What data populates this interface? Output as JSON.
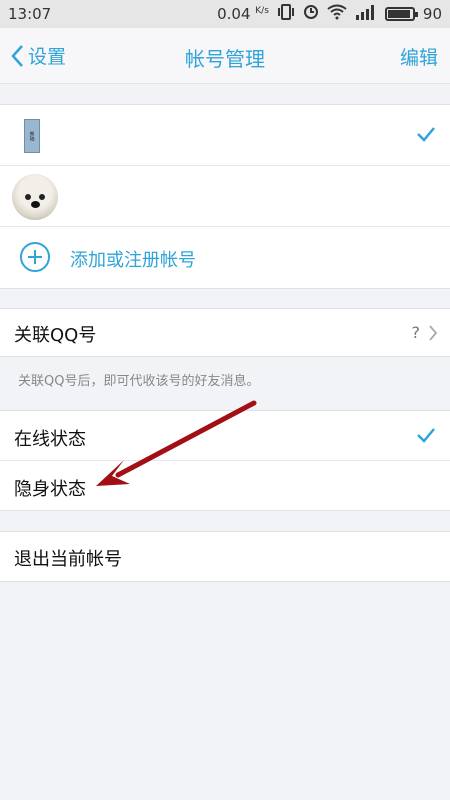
{
  "statusbar": {
    "time": "13:07",
    "speed_value": "0.04",
    "speed_unit": "K/s",
    "battery": "90",
    "icons": [
      "vibrate-icon",
      "alarm-icon",
      "wifi-icon",
      "signal-icon",
      "battery-icon"
    ]
  },
  "navbar": {
    "back_label": "设置",
    "title": "帐号管理",
    "edit_label": "编辑"
  },
  "accounts": {
    "items": [
      {
        "selected": true
      },
      {
        "selected": false
      }
    ],
    "add_label": "添加或注册帐号"
  },
  "link_qq": {
    "label": "关联QQ号",
    "value": "?",
    "hint": "关联QQ号后，即可代收该号的好友消息。"
  },
  "status": {
    "online_label": "在线状态",
    "online_selected": true,
    "invisible_label": "隐身状态",
    "invisible_selected": false
  },
  "logout": {
    "label": "退出当前帐号"
  },
  "colors": {
    "accent": "#2fa4d8",
    "arrow": "#a01014"
  }
}
